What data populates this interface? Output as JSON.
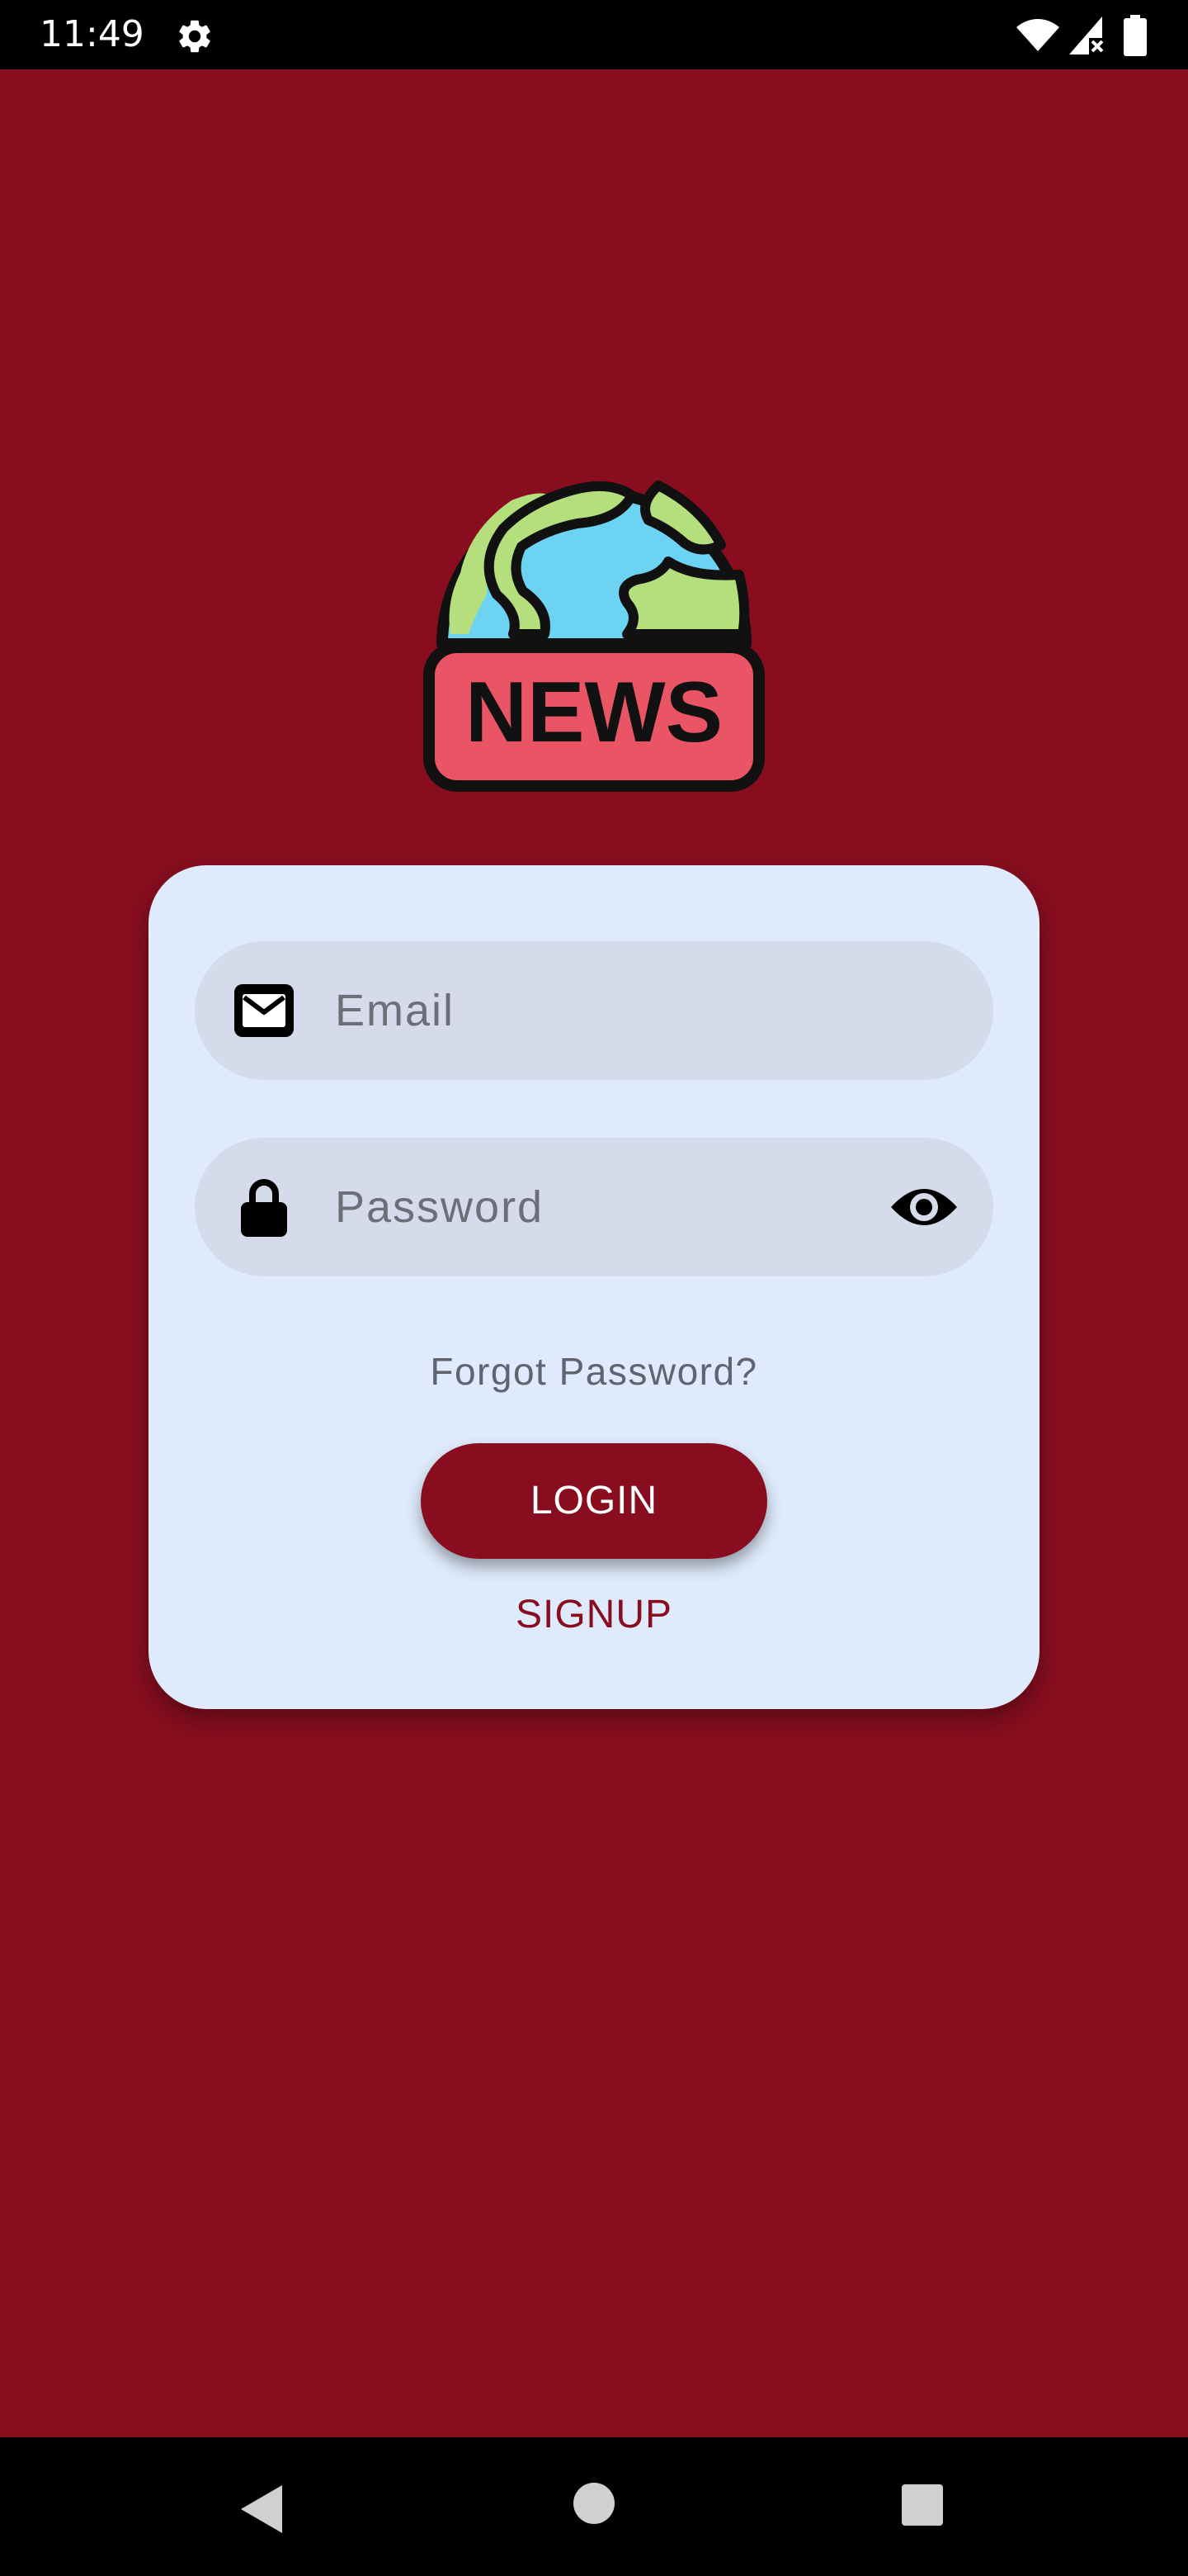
{
  "status_bar": {
    "time": "11:49",
    "icons": [
      "settings-gear-icon",
      "wifi-icon",
      "cell-signal-icon",
      "battery-icon"
    ]
  },
  "logo": {
    "text": "NEWS",
    "colors": {
      "ocean": "#6dd3f2",
      "land": "#b5df7c",
      "badge": "#ea5566",
      "outline": "#111111"
    }
  },
  "form": {
    "email": {
      "placeholder": "Email",
      "value": "",
      "icon": "email-icon"
    },
    "password": {
      "placeholder": "Password",
      "value": "",
      "icon": "lock-icon",
      "toggle_icon": "eye-icon"
    },
    "forgot_label": "Forgot Password?",
    "login_label": "LOGIN",
    "signup_label": "SIGNUP"
  },
  "nav_bar": {
    "icons": [
      "back-icon",
      "home-icon",
      "recents-icon"
    ]
  },
  "theme": {
    "background": "#880e1f",
    "card": "#dfebfc",
    "field": "#d6dbeb",
    "accent": "#880e1f"
  }
}
